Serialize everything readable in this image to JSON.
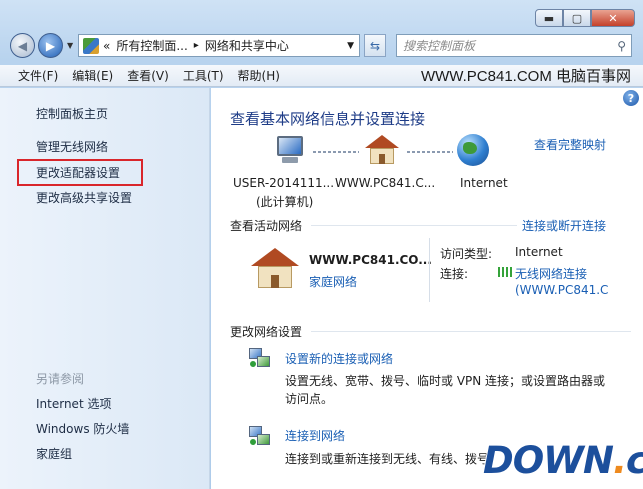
{
  "window": {
    "controls": {
      "minimize": "▬",
      "maximize": "▢",
      "close": "✕"
    }
  },
  "navigation": {
    "breadcrumb_prefix": "«",
    "breadcrumb": [
      "所有控制面...",
      "网络和共享中心"
    ],
    "breadcrumb_sep": "▸",
    "search_placeholder": "搜索控制面板"
  },
  "menubar": {
    "items": [
      "文件(F)",
      "编辑(E)",
      "查看(V)",
      "工具(T)",
      "帮助(H)"
    ],
    "brand_text": "WWW.PC841.COM 电脑百事网"
  },
  "sidebar": {
    "home_link": "控制面板主页",
    "items": [
      "管理无线网络",
      "更改适配器设置",
      "更改高级共享设置"
    ],
    "see_also_title": "另请参阅",
    "see_also": [
      "Internet 选项",
      "Windows 防火墙",
      "家庭组"
    ]
  },
  "main": {
    "title": "查看基本网络信息并设置连接",
    "view_full_map": "查看完整映射",
    "map": {
      "computer_name": "USER-2014111...",
      "computer_sub": "(此计算机)",
      "network_name": "WWW.PC841.C...",
      "internet": "Internet"
    },
    "active_networks": {
      "title": "查看活动网络",
      "connect_disconnect": "连接或断开连接",
      "network_name": "WWW.PC841.CO...",
      "network_type": "家庭网络",
      "access_type_label": "访问类型:",
      "access_type_value": "Internet",
      "connection_label": "连接:",
      "connection_value": "无线网络连接",
      "connection_value2": "(WWW.PC841.C"
    },
    "change_settings": {
      "title": "更改网络设置",
      "items": [
        {
          "link": "设置新的连接或网络",
          "desc": "设置无线、宽带、拨号、临时或 VPN 连接；或设置路由器或访问点。"
        },
        {
          "link": "连接到网络",
          "desc": "连接到或重新连接到无线、有线、拨号"
        }
      ]
    },
    "help": "?"
  },
  "watermark": {
    "text1": "DOWN",
    "dot": ".",
    "text2": "cc"
  }
}
